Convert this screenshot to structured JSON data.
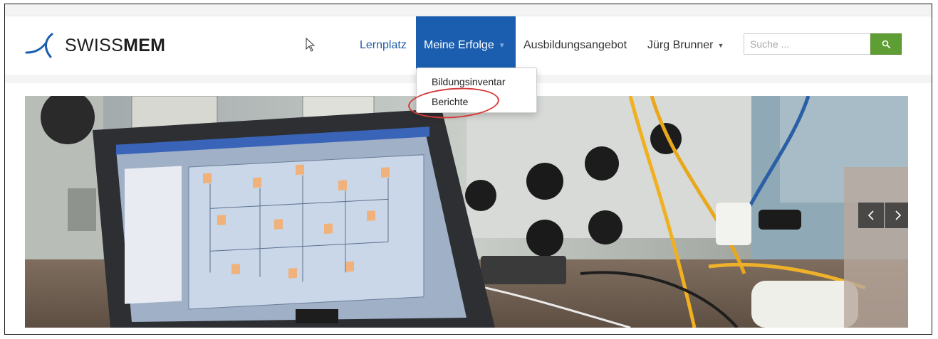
{
  "brand": {
    "prefix": "SWISS",
    "bold": "MEM"
  },
  "nav": {
    "items": [
      {
        "label": "Lernplatz"
      },
      {
        "label": "Meine Erfolge",
        "active": true
      },
      {
        "label": "Ausbildungsangebot"
      },
      {
        "label": "Jürg Brunner"
      }
    ]
  },
  "dropdown": {
    "items": [
      {
        "label": "Bildungsinventar"
      },
      {
        "label": "Berichte",
        "highlighted": true
      }
    ]
  },
  "search": {
    "placeholder": "Suche ...",
    "value": "",
    "icon": "search-icon"
  },
  "carousel": {
    "prev_icon": "chevron-left-icon",
    "next_icon": "chevron-right-icon"
  },
  "colors": {
    "active_nav_bg": "#1b5eb0",
    "link": "#1f5ea8",
    "search_button": "#5f9e35",
    "highlight_ring": "#d63a3a"
  }
}
